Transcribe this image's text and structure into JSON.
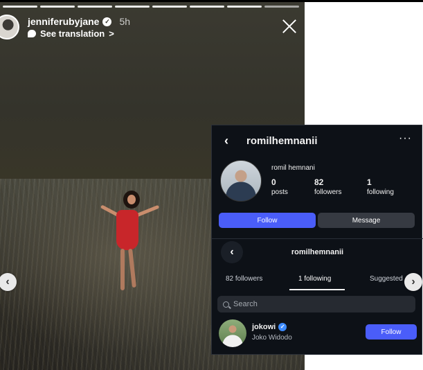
{
  "story": {
    "username": "jenniferubyjane",
    "time": "5h",
    "translate_label": "See translation",
    "translate_chevron": ">",
    "progress_segments": 8,
    "prev_label": "‹",
    "next_label": "›"
  },
  "profile": {
    "back_label": "‹",
    "username": "romilhemnanii",
    "more_label": "···",
    "full_name": "romil hemnani",
    "stats": [
      {
        "num": "0",
        "label": "posts"
      },
      {
        "num": "82",
        "label": "followers"
      },
      {
        "num": "1",
        "label": "following"
      }
    ],
    "follow_label": "Follow",
    "message_label": "Message"
  },
  "following_view": {
    "back_label": "‹",
    "username": "romilhemnanii",
    "tabs": [
      "82 followers",
      "1 following",
      "Suggested"
    ],
    "search_placeholder": "Search",
    "users": [
      {
        "username": "jokowi",
        "full_name": "Joko Widodo",
        "follow_label": "Follow"
      }
    ]
  },
  "colors": {
    "follow_blue": "#4a5df9",
    "profile_bg": "#0d1117",
    "verified_blue": "#3d8bff"
  }
}
